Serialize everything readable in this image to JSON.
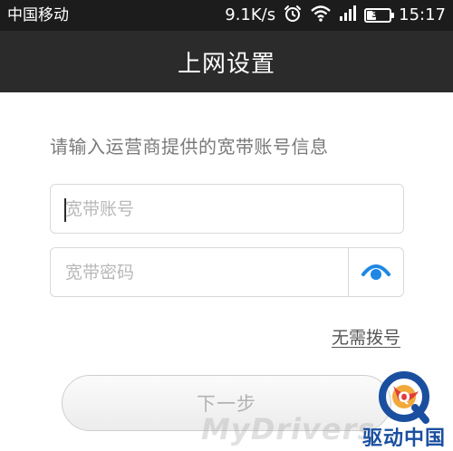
{
  "status_bar": {
    "carrier": "中国移动",
    "net_speed": "9.1K/s",
    "battery_level": "37",
    "time": "15:17",
    "icons": [
      "alarm-icon",
      "wifi-icon",
      "signal-icon",
      "battery-icon"
    ]
  },
  "header": {
    "title": "上网设置"
  },
  "form": {
    "instruction": "请输入运营商提供的宽带账号信息",
    "account_placeholder": "宽带账号",
    "account_value": "",
    "password_placeholder": "宽带密码",
    "password_value": "",
    "toggle_icon": "eye-icon",
    "skip_dial_label": "无需拨号",
    "next_label": "下一步"
  },
  "watermark": {
    "site_text": "MyDrivers",
    "logo_text": "驱动中国",
    "logo_letter": "Q"
  },
  "colors": {
    "status_bg": "#1c1c1c",
    "title_bg": "#2b2b2b",
    "accent": "#1e88e5",
    "button_text": "#b3b3b3"
  }
}
